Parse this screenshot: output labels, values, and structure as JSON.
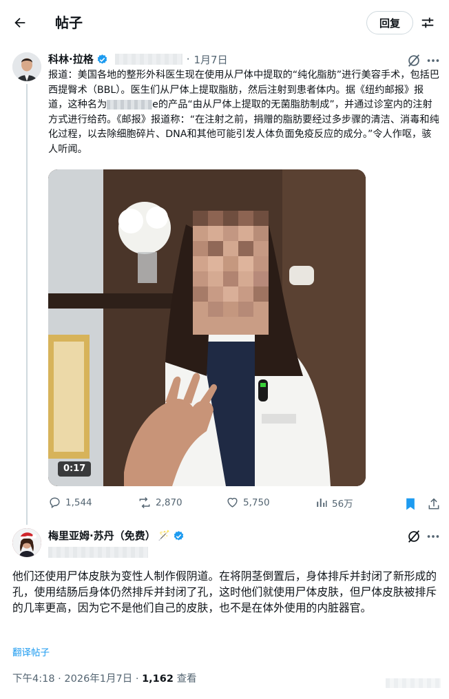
{
  "header": {
    "title": "帖子",
    "reply_label": "回复"
  },
  "post": {
    "author_name": "科林·拉格",
    "date": "1月7日",
    "text_parts": [
      "报道：美国各地的整形外科医生现在使用从尸体中提取的“纯化脂肪”进行美容手术，包括巴西提臀术（BBL）。医生们从尸体上提取脂肪，然后注射到患者体内。据《纽约邮报》报道，这种名为",
      "e的产品“由从尸体上提取的无菌脂肪制成”，并通过诊室内的注射方式进行给药。《邮报》报道称：“在注射之前，捐赠的脂肪要经过多步骤的清洁、消毒和纯化过程，以去除细胞碎片、DNA和其他可能引发人体负面免疫反应的成分。”令人作呕，骇人听闻。"
    ],
    "video_time": "0:17",
    "stats": {
      "replies": "1,544",
      "reposts": "2,870",
      "likes": "5,750",
      "views": "56万"
    }
  },
  "reply": {
    "author_name": "梅里亚姆·苏丹（免费）",
    "badge_emoji": "🪄",
    "text": "他们还使用尸体皮肤为变性人制作假阴道。在将阴茎倒置后，身体排斥并封闭了新形成的孔，使用结肠后身体仍然排斥并封闭了孔，这时他们就使用尸体皮肤，但尸体皮肤被排斥的几率更高，因为它不是他们自己的皮肤，也不是在体外使用的内脏器官。",
    "translate_label": "翻译帖子",
    "time": "下午4:18",
    "date": "2026年1月7日",
    "views_count": "1,162",
    "views_label": "查看"
  },
  "colors": {
    "accent": "#1d9bf0",
    "secondary_text": "#536471",
    "bookmark": "#1d9bf0"
  },
  "icons": [
    "back-arrow-icon",
    "adjust-icon",
    "verified-icon",
    "grok-icon",
    "more-icon",
    "reply-icon",
    "repost-icon",
    "like-icon",
    "views-icon",
    "bookmark-icon",
    "share-icon"
  ]
}
